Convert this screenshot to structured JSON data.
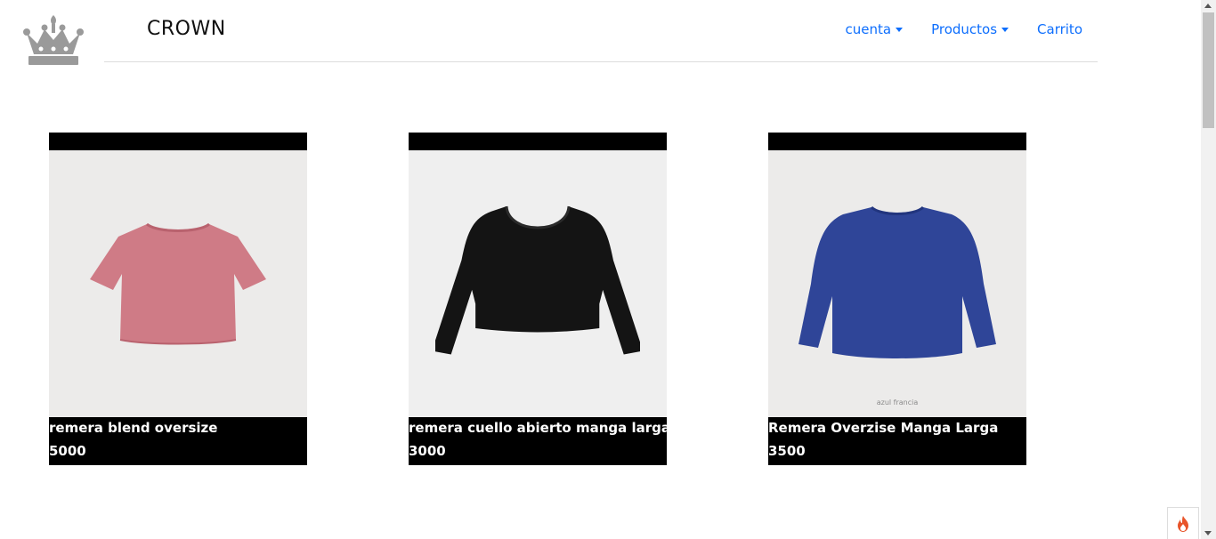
{
  "header": {
    "brand": "CROWN",
    "nav": [
      {
        "label": "cuenta",
        "dropdown": true
      },
      {
        "label": "Productos",
        "dropdown": true
      },
      {
        "label": "Carrito",
        "dropdown": false
      }
    ]
  },
  "products": [
    {
      "name": "remera blend oversize",
      "price": "5000",
      "image": "pink-tshirt",
      "color": "#cf7b86"
    },
    {
      "name": "remera cuello abierto manga larga",
      "price": "3000",
      "image": "black-crop-longsleeve",
      "color": "#141414"
    },
    {
      "name": "Remera Overzise Manga Larga",
      "price": "3500",
      "image": "blue-longsleeve",
      "color": "#2f4598",
      "caption": "azul francia"
    }
  ],
  "colors": {
    "link": "#0d6efd",
    "card": "#000000"
  },
  "icons": [
    "crown-logo",
    "fire-icon"
  ]
}
